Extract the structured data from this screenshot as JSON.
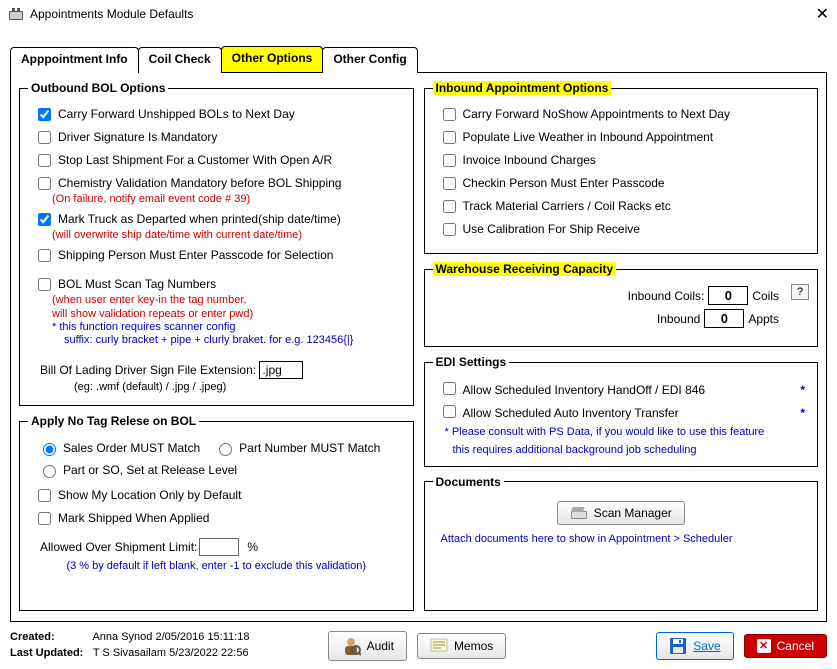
{
  "window": {
    "title": "Appointments Module Defaults"
  },
  "tabs": {
    "t0": "Apppointment Info",
    "t1": "Coil Check",
    "t2": "Other Options",
    "t3": "Other Config"
  },
  "outbound": {
    "legend": "Outbound BOL Options",
    "carry_forward": "Carry Forward Unshipped BOLs to Next Day",
    "driver_sig": "Driver Signature Is Mandatory",
    "stop_last": "Stop Last Shipment For a Customer With Open A/R",
    "chem_valid": "Chemistry Validation Mandatory before BOL Shipping",
    "chem_valid_note": "(On failure, notify email event code # 39)",
    "mark_truck": "Mark Truck as Departed when printed(ship date/time)",
    "mark_truck_note": "(will overwrite ship date/time with current date/time)",
    "ship_passcode": "Shipping Person Must Enter Passcode for Selection",
    "scan_tag": "BOL Must Scan Tag Numbers",
    "scan_tag_note1": "(when user enter key-in the tag number,",
    "scan_tag_note2": "will show validation repeats or enter pwd)",
    "scan_tag_note3": "* this function requires scanner config",
    "scan_tag_note4": "suffix: curly bracket + pipe + clurly braket. for e.g. 123456{|}",
    "fileext_label": "Bill Of Lading Driver Sign File Extension:",
    "fileext_value": ".jpg",
    "fileext_eg": "(eg:   .wmf (default) / .jpg / .jpeg)"
  },
  "notag": {
    "legend": "Apply No Tag Relese on BOL",
    "r1": "Sales Order MUST Match",
    "r2": "Part Number MUST Match",
    "r3": "Part or SO, Set at Release Level",
    "show_loc": "Show My Location Only by Default",
    "mark_shipped": "Mark Shipped When Applied",
    "ovship_label": "Allowed Over Shipment Limit:",
    "ovship_unit": "%",
    "ovship_note": "(3 % by default if left blank, enter -1 to exclude this validation)"
  },
  "inbound_opts": {
    "legend": "Inbound Appointment Options",
    "carry": "Carry Forward NoShow Appointments to Next Day",
    "weather": "Populate Live Weather in Inbound Appointment",
    "invoice": "Invoice Inbound Charges",
    "passcode": "Checkin Person Must Enter Passcode",
    "racks": "Track Material Carriers / Coil Racks etc",
    "calib": "Use Calibration For Ship Receive"
  },
  "capacity": {
    "legend": "Warehouse Receiving Capacity",
    "coils_label": "Inbound Coils:",
    "coils_val": "0",
    "coils_unit": "Coils",
    "appts_label": "Inbound",
    "appts_val": "0",
    "appts_unit": "Appts"
  },
  "edi": {
    "legend": "EDI Settings",
    "handoff": "Allow Scheduled Inventory HandOff / EDI 846",
    "autotrans": "Allow Scheduled Auto Inventory Transfer",
    "note1": "*  Please consult with PS Data, if you would like to use this feature",
    "note2": "this requires additional background job scheduling"
  },
  "docs": {
    "legend": "Documents",
    "scan_btn": "Scan Manager",
    "note": "Attach documents here to show in Appointment > Scheduler"
  },
  "footer": {
    "created_lbl": "Created:",
    "created_val": "Anna Synod 2/05/2016 15:11:18",
    "updated_lbl": "Last Updated:",
    "updated_val": "T S Sivasailam 5/23/2022 22:56",
    "audit": "Audit",
    "memos": "Memos",
    "save": "Save",
    "cancel": "Cancel"
  }
}
